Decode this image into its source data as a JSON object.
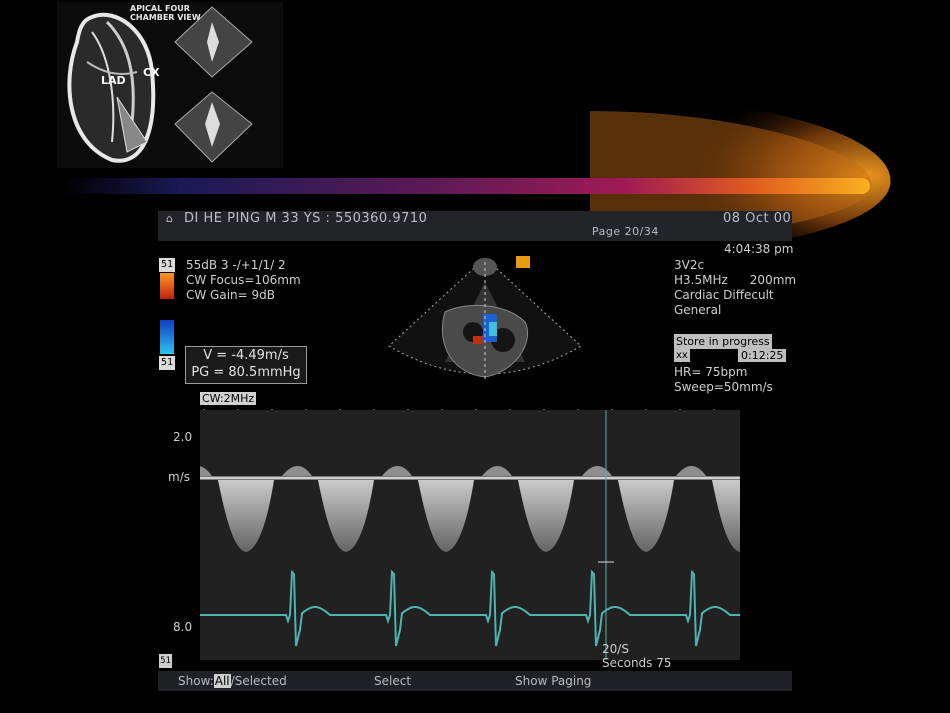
{
  "reference_image": {
    "title": "APICAL FOUR\nCHAMBER VIEW",
    "labels": {
      "lad": "LAD",
      "cx": "CX"
    }
  },
  "header": {
    "patient": "DI HE PING  M 33 YS : 550360.9710",
    "date": "08 Oct 00",
    "page": "Page 20/34",
    "time": "4:04:38 pm"
  },
  "left_info": {
    "grey_chip": "51",
    "color_chip": "51",
    "line1": "55dB  3 -/+1/1/ 2",
    "line2": "CW Focus=106mm",
    "line3": "CW Gain=   9dB"
  },
  "measurement": {
    "velocity": "V = -4.49m/s",
    "gradient": "PG = 80.5mmHg"
  },
  "right_info": {
    "probe": "3V2c",
    "freq": "H3.5MHz",
    "depth": "200mm",
    "preset": "Cardiac Diffecult",
    "mode": "General",
    "store_label": "Store in progress",
    "store_icon": "xx",
    "store_timer": "0:12:25",
    "hr": "HR=  75bpm",
    "sweep": "Sweep=50mm/s"
  },
  "spectral": {
    "mode_label": "CW:2MHz",
    "scale_top": "2.0",
    "unit": "m/s",
    "scale_bottom": "8.0",
    "fps": "20/S",
    "seconds": "Seconds 75",
    "corner_icon": "51"
  },
  "menu": {
    "show_prefix": "Show:",
    "show_all": "All",
    "show_suffix": "/Selected",
    "select": "Select",
    "show_paging": "Show Paging"
  },
  "colors": {
    "ecg": "#4fb3b0",
    "header_bg": "#222428",
    "accent_orange": "#f39a12"
  }
}
